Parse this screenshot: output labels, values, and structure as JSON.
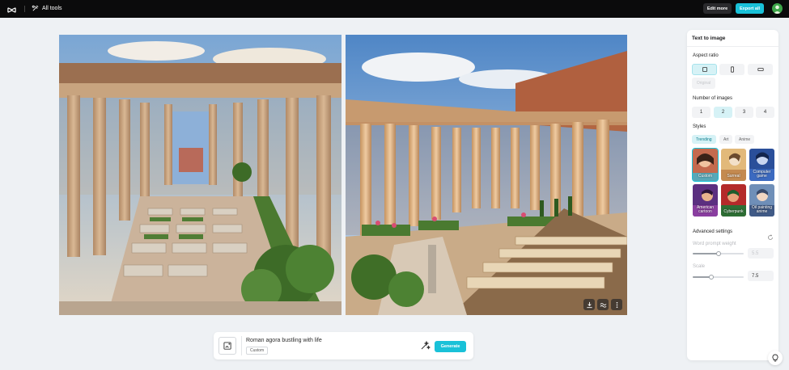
{
  "topbar": {
    "tools_label": "All tools",
    "edit_more_label": "Edit more",
    "export_all_label": "Export all"
  },
  "colors": {
    "accent": "#19c1d8",
    "topbar": "#0b0b0c",
    "canvas": "#eef1f4"
  },
  "images": [
    {
      "subject": "Roman agora colonnade with garden",
      "icons": [
        "download-icon",
        "upscale-icon",
        "more-icon"
      ]
    },
    {
      "subject": "Roman agora colonnade with garden",
      "icons": [
        "download-icon",
        "upscale-icon",
        "more-icon"
      ]
    }
  ],
  "prompt": {
    "text": "Roman agora bustling with life",
    "style_chip": "Custom",
    "generate_label": "Generate"
  },
  "panel": {
    "title": "Text to image",
    "aspect_ratio_label": "Aspect ratio",
    "aspect_ratio_selected": "square",
    "original_label": "Original",
    "num_images_label": "Number of images",
    "num_images_options": [
      "1",
      "2",
      "3",
      "4"
    ],
    "num_images_selected": "2",
    "styles_label": "Styles",
    "style_tabs": [
      "Trending",
      "Art",
      "Anime"
    ],
    "style_tab_selected": "Trending",
    "styles": [
      "Custom",
      "Surreal",
      "Computer game",
      "American cartoon",
      "Cyberpunk",
      "Oil painting anime"
    ],
    "style_selected": "Custom",
    "advanced_label": "Advanced settings",
    "word_prompt_weight_label": "Word prompt weight",
    "word_prompt_weight_value": "5.5",
    "word_prompt_weight_fraction": 0.5,
    "scale_label": "Scale",
    "scale_value": "7.5",
    "scale_fraction": 0.37
  }
}
